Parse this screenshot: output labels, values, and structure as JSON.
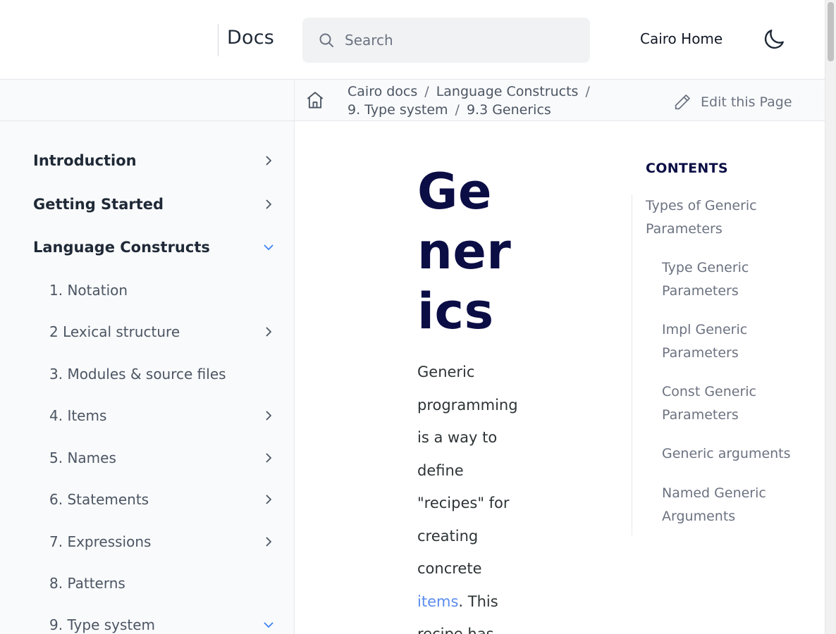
{
  "header": {
    "logo_text": "Docs",
    "search_placeholder": "Search",
    "home_link": "Cairo Home"
  },
  "breadcrumb": {
    "items": [
      "Cairo docs",
      "Language Constructs",
      "9. Type system",
      "9.3 Generics"
    ],
    "separator": "/",
    "edit_label": "Edit this Page"
  },
  "sidebar": {
    "top_items": [
      {
        "label": "Introduction",
        "expanded": false
      },
      {
        "label": "Getting Started",
        "expanded": false
      },
      {
        "label": "Language Constructs",
        "expanded": true
      }
    ],
    "sub_items": [
      {
        "label": "1. Notation",
        "has_children": false
      },
      {
        "label": "2 Lexical structure",
        "has_children": true
      },
      {
        "label": "3. Modules & source files",
        "has_children": false
      },
      {
        "label": "4. Items",
        "has_children": true
      },
      {
        "label": "5. Names",
        "has_children": true
      },
      {
        "label": "6. Statements",
        "has_children": true
      },
      {
        "label": "7. Expressions",
        "has_children": true
      },
      {
        "label": "8. Patterns",
        "has_children": false
      },
      {
        "label": "9. Type system",
        "has_children": true,
        "expanded": true
      }
    ]
  },
  "main": {
    "title": "Generics",
    "intro_before_link": "Generic programming is a way to define \"recipes\" for creating concrete ",
    "intro_link": "items",
    "intro_after_link": ". This recipe has"
  },
  "toc": {
    "title": "CONTENTS",
    "items": [
      {
        "label": "Types of Generic Parameters",
        "level": 1
      },
      {
        "label": "Type Generic Parameters",
        "level": 2
      },
      {
        "label": "Impl Generic Parameters",
        "level": 2
      },
      {
        "label": "Const Generic Parameters",
        "level": 2
      },
      {
        "label": "Generic arguments",
        "level": 2
      },
      {
        "label": "Named Generic Arguments",
        "level": 2
      }
    ]
  },
  "colors": {
    "heading": "#0b0d45",
    "link": "#5b8def",
    "chevron_expanded": "#3b82f6",
    "chevron_collapsed": "#4b5563"
  },
  "icons": [
    "search-icon",
    "moon-icon",
    "home-icon",
    "pencil-icon",
    "chevron-right-icon",
    "chevron-down-icon"
  ]
}
